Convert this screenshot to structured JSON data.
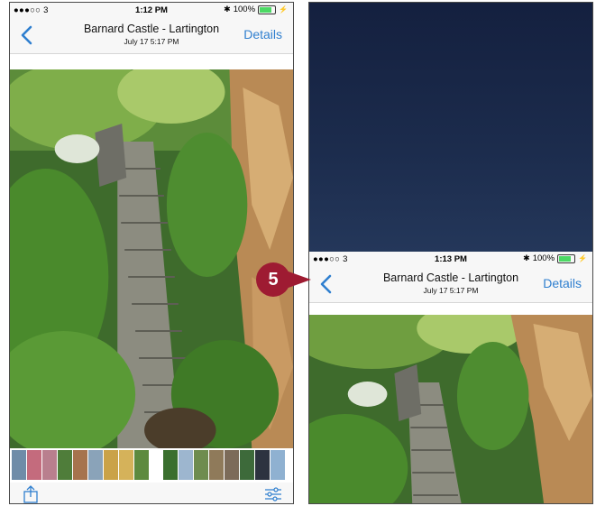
{
  "left_phone": {
    "status": {
      "carrier": "●●●○○ 3",
      "time": "1:12 PM",
      "battery": "100%"
    },
    "nav": {
      "title": "Barnard Castle - Lartington",
      "subtitle": "July 17  5:17 PM",
      "details": "Details"
    }
  },
  "right_phone": {
    "status": {
      "carrier": "●●●○○ 3",
      "time": "1:13 PM",
      "battery": "100%"
    },
    "nav": {
      "title": "Barnard Castle - Lartington",
      "subtitle": "July 17  5:17 PM",
      "details": "Details"
    }
  },
  "callout": {
    "number": "5"
  },
  "colors": {
    "accent": "#2f7fcf",
    "callout": "#9e1b32",
    "battery": "#4cd964"
  },
  "icons": {
    "back": "chevron-left-icon",
    "share": "share-icon",
    "adjust": "sliders-icon",
    "bluetooth": "bluetooth-icon",
    "wifi": "wifi-icon",
    "battery": "battery-icon"
  },
  "filmstrip": {
    "thumbnails": [
      "#6f8ca8",
      "#c46b7d",
      "#b97f8e",
      "#4f7d3a",
      "#a6734d",
      "#8aa3b9",
      "#caa248",
      "#d5b25a",
      "#5d8a3e",
      "#3a6f2e",
      "#9db6cf",
      "#6e8c4f",
      "#8f7a5a",
      "#7c6b59",
      "#3d6a3a",
      "#2d3340",
      "#8fb1d1",
      "#5e8a3f"
    ]
  }
}
